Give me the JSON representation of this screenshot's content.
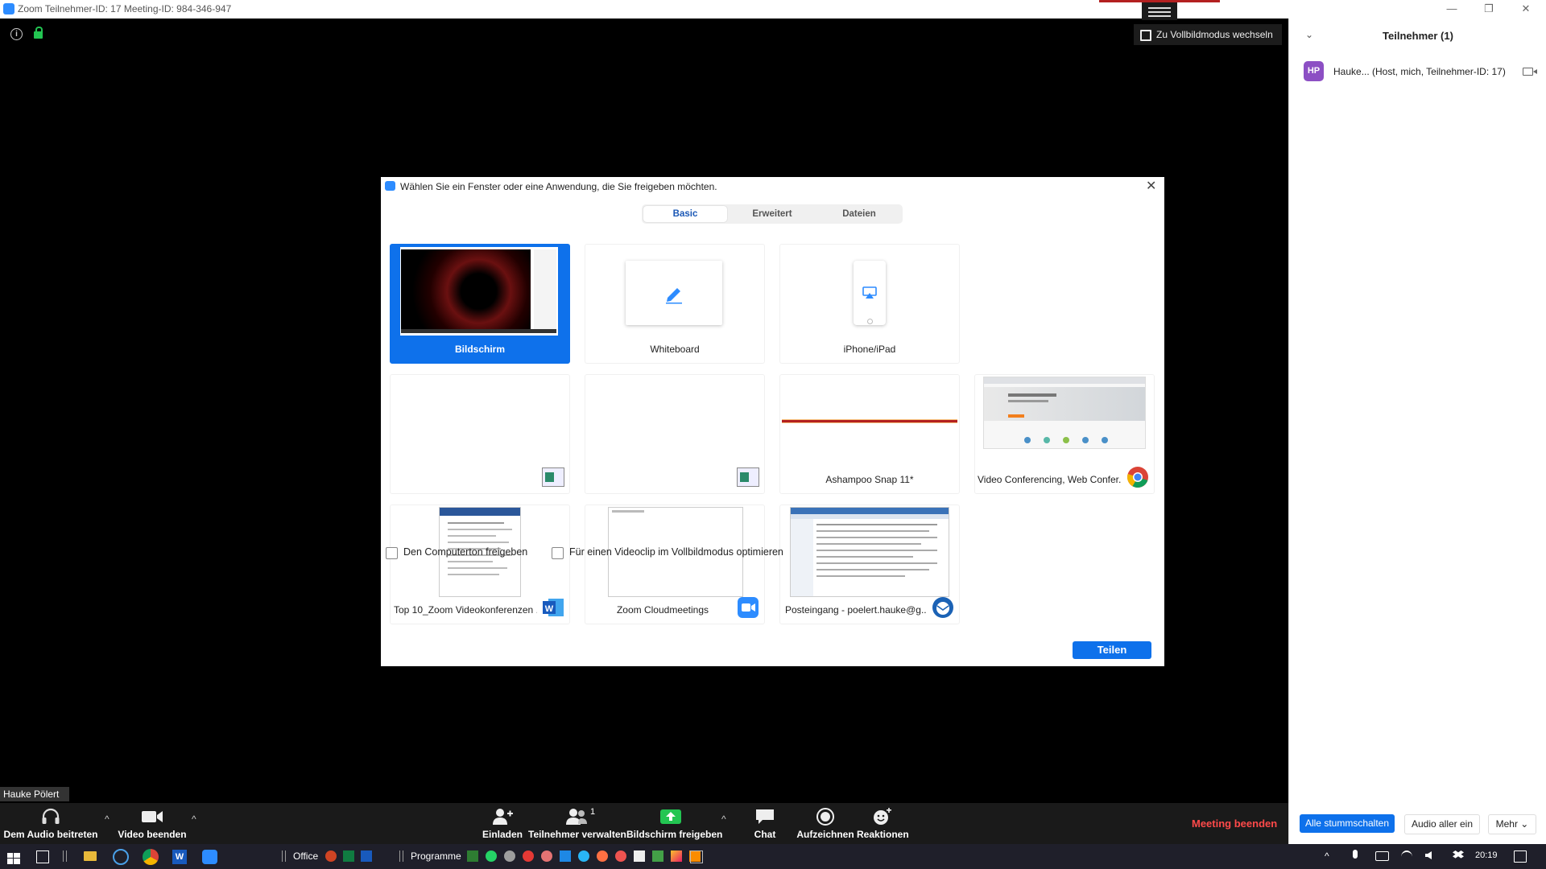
{
  "window": {
    "title": "Zoom Teilnehmer-ID: 17   Meeting-ID: 984-346-947",
    "min_glyph": "—",
    "restore_glyph": "❐",
    "close_glyph": "✕"
  },
  "meeting": {
    "fullscreen_label": "Zu Vollbildmodus wechseln",
    "info_glyph": "i",
    "name_tag": "Hauke Pölert"
  },
  "participants_panel": {
    "title": "Teilnehmer (1)",
    "collapse_glyph": "⌄",
    "participant": {
      "initials": "HP",
      "label": "Hauke... (Host, mich, Teilnehmer-ID: 17)",
      "avatar_color": "#8c4fc4"
    },
    "buttons": {
      "mute_all": "Alle stummschalten",
      "unmute_all": "Audio aller ein",
      "more": "Mehr ⌄"
    }
  },
  "dialog": {
    "title": "Wählen Sie ein Fenster oder eine Anwendung, die Sie freigeben möchten.",
    "close_glyph": "✕",
    "tabs": [
      "Basic",
      "Erweitert",
      "Dateien"
    ],
    "active_tab": 0,
    "tiles": [
      {
        "label": "Bildschirm",
        "selected": true
      },
      {
        "label": "Whiteboard"
      },
      {
        "label": "iPhone/iPad"
      },
      {
        "label": ""
      },
      {
        "label": ""
      },
      {
        "label": "Ashampoo Snap 11*"
      },
      {
        "label": "Video Conferencing, Web Confer..."
      },
      {
        "label": "Top 10_Zoom Videokonferenzen ..."
      },
      {
        "label": "Zoom Cloudmeetings"
      },
      {
        "label": "Posteingang - poelert.hauke@g..."
      }
    ],
    "options": {
      "computer_audio": "Den Computerton freigeben",
      "optimize_video": "Für einen Videoclip im Vollbildmodus optimieren"
    },
    "share_button": "Teilen"
  },
  "toolbar": {
    "join_audio": "Dem Audio beitreten",
    "stop_video": "Video beenden",
    "invite": "Einladen",
    "manage_participants": "Teilnehmer verwalten",
    "participant_count": "1",
    "share_screen": "Bildschirm freigeben",
    "chat": "Chat",
    "record": "Aufzeichnen",
    "reactions": "Reaktionen",
    "caret": "^",
    "end_meeting": "Meeting beenden",
    "accent": "#0e71eb",
    "end_color": "#ff4a4a"
  },
  "taskbar": {
    "office_label": "Office",
    "programs_label": "Programme",
    "clock": "20:19"
  }
}
